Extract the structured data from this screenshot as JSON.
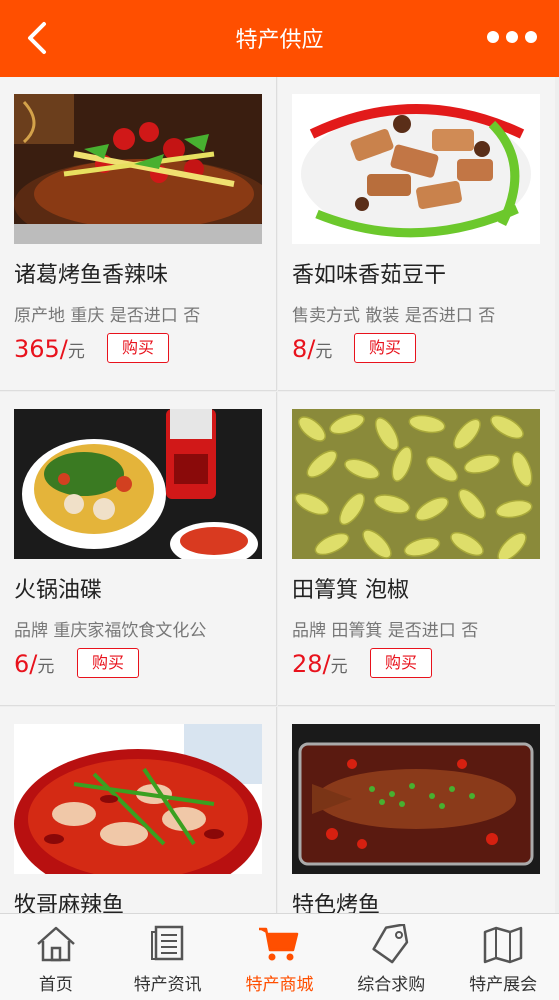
{
  "header": {
    "title": "特产供应",
    "back_icon": "chevron-left-icon",
    "more_icon": "more-dots-icon"
  },
  "products": [
    {
      "name": "诸葛烤鱼香辣味",
      "attr": "原产地 重庆 是否进口 否",
      "price": "365/",
      "unit": "元",
      "buy": "购买"
    },
    {
      "name": "香如味香茹豆干",
      "attr": "售卖方式 散装 是否进口 否",
      "price": "8/",
      "unit": "元",
      "buy": "购买"
    },
    {
      "name": "火锅油碟",
      "attr": "品牌 重庆家福饮食文化公",
      "price": "6/",
      "unit": "元",
      "buy": "购买"
    },
    {
      "name": "田箐箕 泡椒",
      "attr": "品牌 田箐箕 是否进口 否",
      "price": "28/",
      "unit": "元",
      "buy": "购买"
    },
    {
      "name": "牧哥麻辣鱼",
      "attr": "",
      "price": "",
      "unit": "",
      "buy": ""
    },
    {
      "name": "特色烤鱼",
      "attr": "",
      "price": "",
      "unit": "",
      "buy": ""
    }
  ],
  "tabs": [
    {
      "label": "首页",
      "icon": "home-icon"
    },
    {
      "label": "特产资讯",
      "icon": "news-icon"
    },
    {
      "label": "特产商城",
      "icon": "cart-icon",
      "active": true
    },
    {
      "label": "综合求购",
      "icon": "tag-icon"
    },
    {
      "label": "特产展会",
      "icon": "map-icon"
    }
  ],
  "colors": {
    "accent": "#ff4f00",
    "price": "#e8121c"
  }
}
